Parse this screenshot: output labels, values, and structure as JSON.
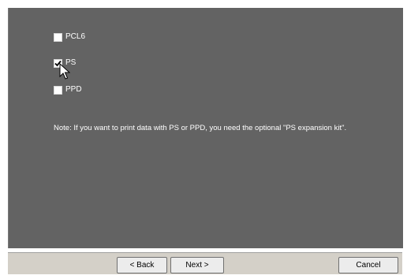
{
  "options": [
    {
      "label": "PCL6",
      "checked": false
    },
    {
      "label": "PS",
      "checked": true
    },
    {
      "label": "PPD",
      "checked": false
    }
  ],
  "note": "Note: If you want to print data with PS or PPD, you need the optional \"PS expansion kit\".",
  "buttons": {
    "back_label": "< Back",
    "next_label": "Next >",
    "cancel_label": "Cancel"
  },
  "colors": {
    "panel_background": "#636363",
    "footer_background": "#d4d0c8",
    "text": "#ffffff"
  },
  "icons": {
    "cursor": "arrow-cursor-icon",
    "check": "checkmark-icon"
  }
}
